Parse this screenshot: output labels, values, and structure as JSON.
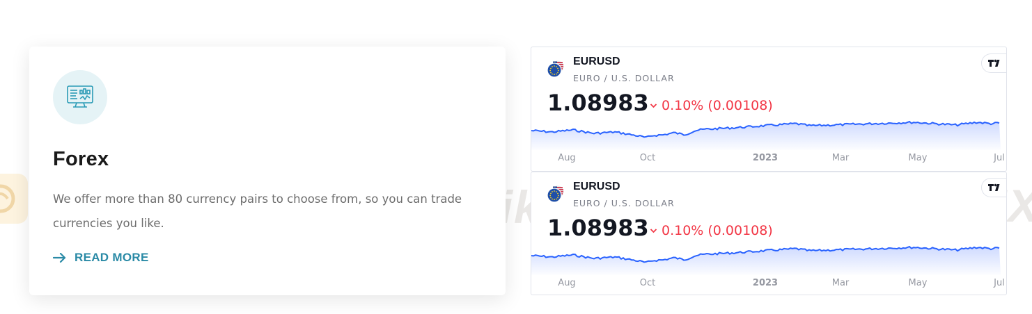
{
  "feature": {
    "icon": "monitor-chart-icon",
    "title": "Forex",
    "description": "We offer more than 80 currency pairs to choose from, so you can trade currencies you like.",
    "link_label": "READ MORE",
    "accent": "#2a8aa6"
  },
  "watermark": {
    "text": "WikiFX"
  },
  "tickers": [
    {
      "symbol": "EURUSD",
      "description": "EURO / U.S. DOLLAR",
      "price": "1.08983",
      "change_pct": "0.10%",
      "change_abs": "(0.00108)",
      "direction": "down",
      "axis_labels": [
        "Aug",
        "Oct",
        "2023",
        "Mar",
        "May",
        "Jul"
      ]
    },
    {
      "symbol": "EURUSD",
      "description": "EURO / U.S. DOLLAR",
      "price": "1.08983",
      "change_pct": "0.10%",
      "change_abs": "(0.00108)",
      "direction": "down",
      "axis_labels": [
        "Aug",
        "Oct",
        "2023",
        "Mar",
        "May",
        "Jul"
      ]
    }
  ],
  "colors": {
    "negative": "#f23645",
    "line": "#2962ff",
    "area": "#c9d6ff"
  }
}
